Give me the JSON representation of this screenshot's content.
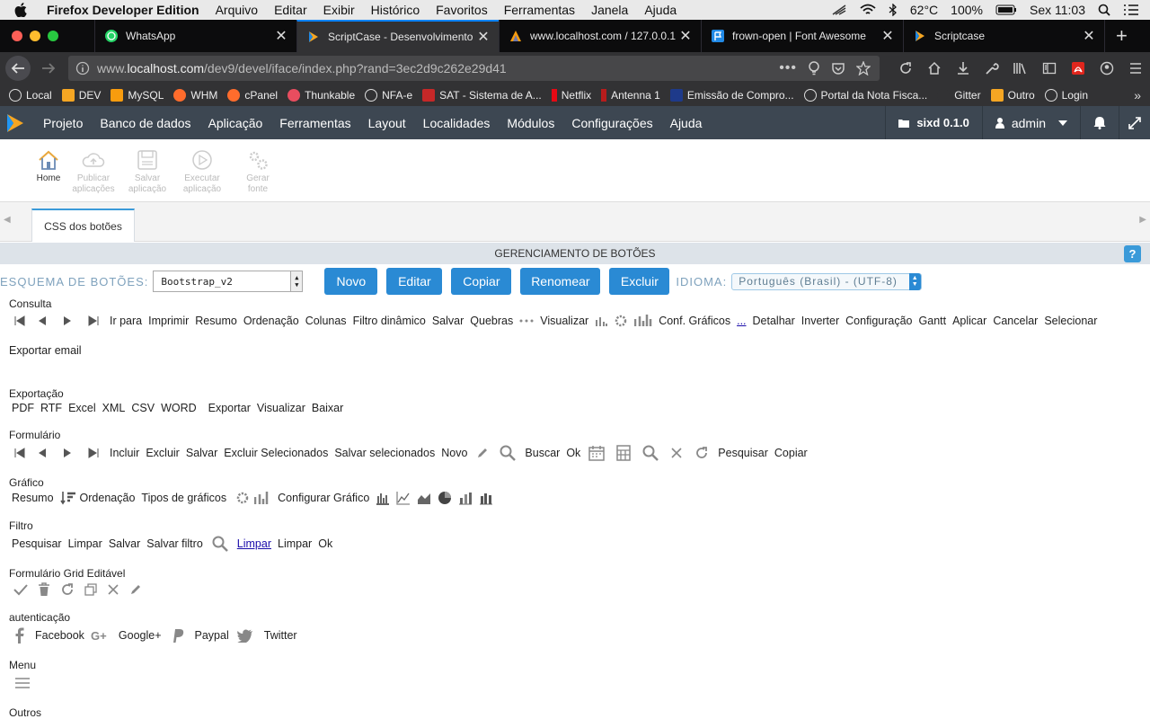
{
  "mac": {
    "app": "Firefox Developer Edition",
    "menus": [
      "Arquivo",
      "Editar",
      "Exibir",
      "Histórico",
      "Favoritos",
      "Ferramentas",
      "Janela",
      "Ajuda"
    ],
    "temp": "62°C",
    "battery": "100%",
    "clock": "Sex 11:03"
  },
  "tabs": [
    {
      "title": "WhatsApp"
    },
    {
      "title": "ScriptCase - Desenvolvimento"
    },
    {
      "title": "www.localhost.com / 127.0.0.1"
    },
    {
      "title": "frown-open | Font Awesome"
    },
    {
      "title": "Scriptcase"
    }
  ],
  "url": {
    "prefix": "www.",
    "host": "localhost.com",
    "path": "/dev9/devel/iface/index.php?rand=3ec2d9c262e29d41"
  },
  "bookmarks": [
    "Local",
    "DEV",
    "MySQL",
    "WHM",
    "cPanel",
    "Thunkable",
    "NFA-e",
    "SAT - Sistema de A...",
    "Netflix",
    "Antenna 1",
    "Emissão de Compro...",
    "Portal da Nota Fisca...",
    "Gitter",
    "Outro",
    "Login"
  ],
  "appnav": {
    "menus": [
      "Projeto",
      "Banco de dados",
      "Aplicação",
      "Ferramentas",
      "Layout",
      "Localidades",
      "Módulos",
      "Configurações",
      "Ajuda"
    ],
    "project": "sixd 0.1.0",
    "user": "admin"
  },
  "toolbar": {
    "home": "Home",
    "publish": [
      "Publicar",
      "aplicações"
    ],
    "save": [
      "Salvar",
      "aplicação"
    ],
    "run": [
      "Executar",
      "aplicação"
    ],
    "gen": [
      "Gerar",
      "fonte"
    ]
  },
  "content_tab": "CSS dos botões",
  "page_title": "GERENCIAMENTO DE BOTÕES",
  "help": "?",
  "scheme": {
    "label": "ESQUEMA DE BOTÕES:",
    "value": "Bootstrap_v2",
    "buttons": [
      "Novo",
      "Editar",
      "Copiar",
      "Renomear",
      "Excluir"
    ],
    "lang_label": "IDIOMA:",
    "lang_value": "Português (Brasil) - (UTF-8)"
  },
  "sections": {
    "consulta": {
      "title": "Consulta",
      "items": [
        "Ir para",
        "Imprimir",
        "Resumo",
        "Ordenação",
        "Colunas",
        "Filtro dinâmico",
        "Salvar",
        "Quebras",
        "Visualizar",
        "Conf. Gráficos",
        "...",
        "Detalhar",
        "Inverter",
        "Configuração",
        "Gantt",
        "Aplicar",
        "Cancelar",
        "Selecionar"
      ],
      "extra": "Exportar email"
    },
    "exportacao": {
      "title": "Exportação",
      "items": [
        "PDF",
        "RTF",
        "Excel",
        "XML",
        "CSV",
        "WORD",
        "Exportar",
        "Visualizar",
        "Baixar"
      ]
    },
    "formulario": {
      "title": "Formulário",
      "items": [
        "Incluir",
        "Excluir",
        "Salvar",
        "Excluir Selecionados",
        "Salvar selecionados",
        "Novo",
        "Buscar",
        "Ok",
        "Pesquisar",
        "Copiar"
      ]
    },
    "grafico": {
      "title": "Gráfico",
      "items": [
        "Resumo",
        "Ordenação",
        "Tipos de gráficos",
        "Configurar Gráfico"
      ]
    },
    "filtro": {
      "title": "Filtro",
      "items": [
        "Pesquisar",
        "Limpar",
        "Salvar",
        "Salvar filtro",
        "Limpar",
        "Limpar",
        "Ok"
      ]
    },
    "grid": {
      "title": "Formulário Grid Editável"
    },
    "auth": {
      "title": "autenticação",
      "items": [
        "Facebook",
        "Google+",
        "Paypal",
        "Twitter"
      ]
    },
    "menu": {
      "title": "Menu"
    },
    "outros": {
      "title": "Outros"
    }
  }
}
